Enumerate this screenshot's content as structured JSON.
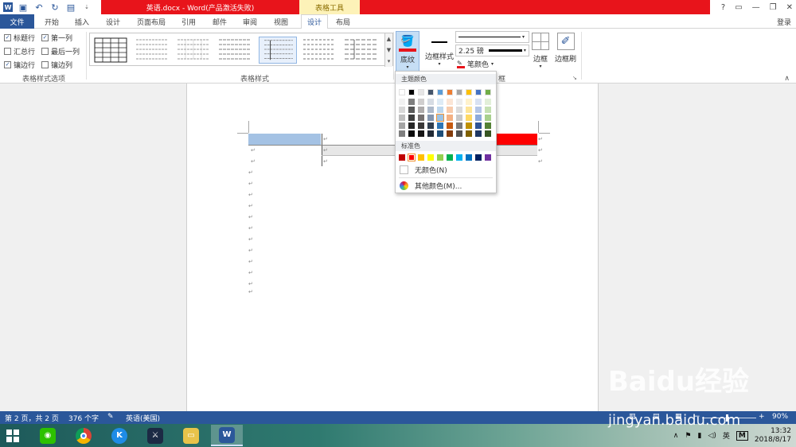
{
  "window": {
    "title": "英语.docx - Word(产品激活失败)",
    "context_group": "表格工具",
    "help": "?",
    "login": "登录"
  },
  "tabs": [
    "文件",
    "开始",
    "插入",
    "设计",
    "页面布局",
    "引用",
    "邮件",
    "审阅",
    "视图",
    "设计",
    "布局"
  ],
  "ribbon": {
    "style_options": {
      "items": [
        {
          "label": "标题行",
          "checked": true
        },
        {
          "label": "第一列",
          "checked": true
        },
        {
          "label": "汇总行",
          "checked": false
        },
        {
          "label": "最后一列",
          "checked": false
        },
        {
          "label": "镶边行",
          "checked": true
        },
        {
          "label": "镶边列",
          "checked": false
        }
      ],
      "group_label": "表格样式选项"
    },
    "table_styles": {
      "group_label": "表格样式"
    },
    "shading": {
      "label": "底纹",
      "color": "#e8141b"
    },
    "border_style": {
      "label": "边框样式"
    },
    "pen_weight": "2.25 磅",
    "pen_color": "笔颜色",
    "borders": "边框",
    "border_painter": "边框刷",
    "borders_group_tail": "框"
  },
  "shading_menu": {
    "theme_header": "主题颜色",
    "standard_header": "标准色",
    "no_color": "无颜色(N)",
    "more_colors": "其他颜色(M)...",
    "theme_top": [
      "#ffffff",
      "#000000",
      "#e7e6e6",
      "#44546a",
      "#5b9bd5",
      "#ed7d31",
      "#a5a5a5",
      "#ffc000",
      "#4472c4",
      "#70ad47"
    ],
    "theme_shades": [
      [
        "#f2f2f2",
        "#7f7f7f",
        "#d0cece",
        "#d6dce4",
        "#deebf6",
        "#fbe5d5",
        "#ededed",
        "#fff2cc",
        "#d9e2f3",
        "#e2efd9"
      ],
      [
        "#d8d8d8",
        "#595959",
        "#aeabab",
        "#adb9ca",
        "#bdd7ee",
        "#f7cbac",
        "#dbdbdb",
        "#fee599",
        "#b4c6e7",
        "#c5e0b3"
      ],
      [
        "#bfbfbf",
        "#3f3f3f",
        "#757070",
        "#8496b0",
        "#9cc3e5",
        "#f4b183",
        "#c9c9c9",
        "#ffd965",
        "#8eaadb",
        "#a8d08d"
      ],
      [
        "#a5a5a5",
        "#262626",
        "#3a3838",
        "#323f4f",
        "#2e75b5",
        "#c55a11",
        "#7b7b7b",
        "#bf9000",
        "#2f5496",
        "#538135"
      ],
      [
        "#7f7f7f",
        "#0c0c0c",
        "#171616",
        "#222a35",
        "#1e4e79",
        "#833c0b",
        "#525252",
        "#7f6000",
        "#1f3864",
        "#375623"
      ]
    ],
    "standard": [
      "#c00000",
      "#ff0000",
      "#ffc000",
      "#ffff00",
      "#92d050",
      "#00b050",
      "#00b0f0",
      "#0070c0",
      "#002060",
      "#7030a0"
    ]
  },
  "statusbar": {
    "page": "第 2 页，共 2 页",
    "words": "376 个字",
    "language": "英语(美国)",
    "zoom": "90%"
  },
  "taskbar": {
    "ime": "英",
    "time": "13:32",
    "date": "2018/8/17"
  },
  "watermark": {
    "brand": "Baidu经验",
    "url": "jingyan.baidu.com"
  }
}
